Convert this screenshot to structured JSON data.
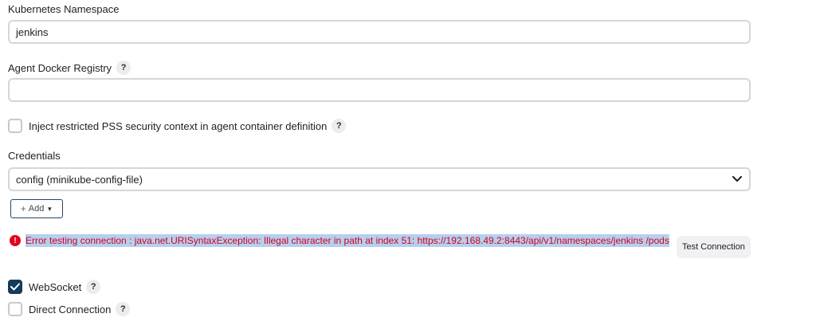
{
  "namespace": {
    "label": "Kubernetes Namespace",
    "value": "jenkins"
  },
  "registry": {
    "label": "Agent Docker Registry",
    "help": "?",
    "value": ""
  },
  "pss": {
    "label": "Inject restricted PSS security context in agent container definition",
    "help": "?",
    "checked": false
  },
  "credentials": {
    "label": "Credentials",
    "selected": "config (minikube-config-file)",
    "add_label": "Add",
    "add_plus": "+",
    "add_caret": "▼"
  },
  "error": {
    "icon": "!",
    "message": "Error testing connection : java.net.URISyntaxException: Illegal character in path at index 51: https://192.168.49.2:8443/api/v1/namespaces/jenkins /pods"
  },
  "test_connection": {
    "label": "Test Connection"
  },
  "websocket": {
    "label": "WebSocket",
    "help": "?",
    "checked": true
  },
  "direct_connection": {
    "label": "Direct Connection",
    "help": "?",
    "checked": false
  },
  "colors": {
    "checked_bg": "#153a5e",
    "error": "#d4001a",
    "selection": "#b6cfef"
  }
}
